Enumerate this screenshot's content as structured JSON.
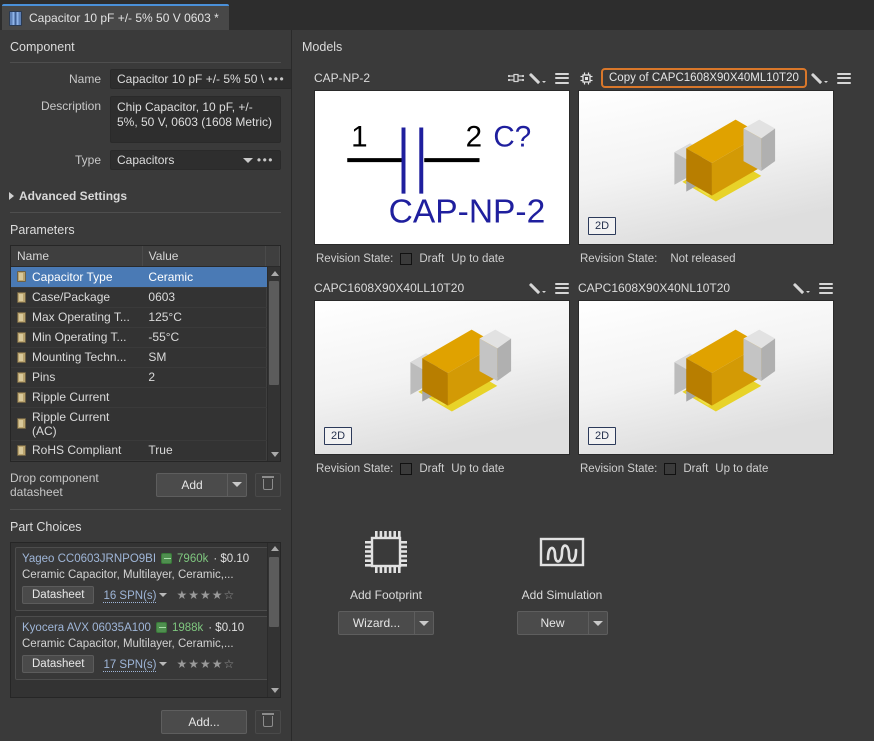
{
  "titlebar": {
    "tab_label": "Capacitor 10 pF +/- 5% 50 V 0603 *",
    "tab_icon": "capacitor-icon"
  },
  "component": {
    "section_title": "Component",
    "name_label": "Name",
    "name_value": "Capacitor 10 pF +/- 5% 50 \\",
    "name_menu": "•••",
    "description_label": "Description",
    "description_value": "Chip Capacitor, 10 pF, +/- 5%, 50 V, 0603 (1608 Metric)",
    "type_label": "Type",
    "type_value": "Capacitors",
    "type_menu": "•••",
    "advanced_settings": "Advanced Settings"
  },
  "parameters": {
    "section_title": "Parameters",
    "columns": [
      "Name",
      "Value"
    ],
    "rows": [
      {
        "name": "Capacitor Type",
        "value": "Ceramic",
        "selected": true
      },
      {
        "name": "Case/Package",
        "value": "0603",
        "selected": false
      },
      {
        "name": "Max Operating T...",
        "value": "125°C",
        "selected": false
      },
      {
        "name": "Min Operating T...",
        "value": "-55°C",
        "selected": false
      },
      {
        "name": "Mounting Techn...",
        "value": "SM",
        "selected": false
      },
      {
        "name": "Pins",
        "value": "2",
        "selected": false
      },
      {
        "name": "Ripple Current",
        "value": "",
        "selected": false
      },
      {
        "name": "Ripple Current (AC)",
        "value": "",
        "selected": false
      },
      {
        "name": "RoHS Compliant",
        "value": "True",
        "selected": false
      }
    ]
  },
  "datasheet": {
    "drop_text": "Drop component datasheet",
    "add_label": "Add",
    "delete_icon": "trash-icon"
  },
  "part_choices": {
    "section_title": "Part Choices",
    "items": [
      {
        "title": "Yageo CC0603JRNPO9BI",
        "stock": "7960k",
        "price": "· $0.10",
        "description": "Ceramic Capacitor, Multilayer, Ceramic,...",
        "datasheet_label": "Datasheet",
        "spn_label": "16 SPN(s)",
        "stars": "★★★★☆"
      },
      {
        "title": "Kyocera AVX 06035A100",
        "stock": "1988k",
        "price": "· $0.10",
        "description": "Ceramic Capacitor, Multilayer, Ceramic,...",
        "datasheet_label": "Datasheet",
        "spn_label": "17 SPN(s)",
        "stars": "★★★★☆"
      }
    ],
    "add_label": "Add...",
    "delete_icon": "trash-icon"
  },
  "models": {
    "section_title": "Models",
    "revision_label": "Revision State:",
    "cards": [
      {
        "name": "CAP-NP-2",
        "type": "schematic",
        "highlighted": false,
        "icons": [
          "pin-map-icon",
          "pencil-icon",
          "menu-icon"
        ],
        "schematic": {
          "pin1": "1",
          "pin2": "2",
          "designator": "C?",
          "label": "CAP-NP-2"
        },
        "revision_state": "Draft",
        "revision_status": "Up to date",
        "has_checkbox": true,
        "badge": ""
      },
      {
        "name": "Copy of CAPC1608X90X40ML10T20",
        "type": "model3d",
        "highlighted": true,
        "icons": [
          "chip-icon",
          "pencil-icon",
          "menu-icon"
        ],
        "revision_state": "",
        "revision_status": "Not released",
        "has_checkbox": false,
        "badge": "2D"
      },
      {
        "name": "CAPC1608X90X40LL10T20",
        "type": "model3d",
        "highlighted": false,
        "icons": [
          "pencil-icon",
          "menu-icon"
        ],
        "revision_state": "Draft",
        "revision_status": "Up to date",
        "has_checkbox": true,
        "badge": "2D"
      },
      {
        "name": "CAPC1608X90X40NL10T20",
        "type": "model3d",
        "highlighted": false,
        "icons": [
          "pencil-icon",
          "menu-icon"
        ],
        "revision_state": "Draft",
        "revision_status": "Up to date",
        "has_checkbox": true,
        "badge": "2D"
      }
    ],
    "adders": [
      {
        "label": "Add Footprint",
        "icon": "qfp-chip-icon",
        "button": "Wizard..."
      },
      {
        "label": "Add Simulation",
        "icon": "waveform-icon",
        "button": "New"
      }
    ]
  },
  "colors": {
    "accent_orange": "#d9772a",
    "selection_blue": "#4a7ab5",
    "stock_green": "#7fc77f",
    "link_blue": "#9fb6d8",
    "schematic_blue": "#1f1f9e"
  }
}
